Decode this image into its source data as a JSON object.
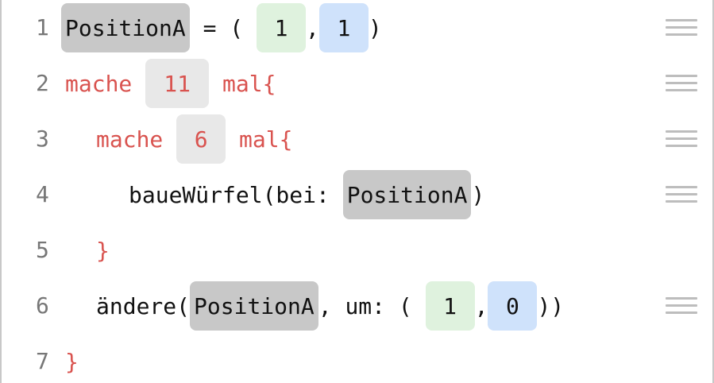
{
  "lines": [
    {
      "number": "1",
      "var_name": "PositionA",
      "assign": " = ( ",
      "x": "1",
      "comma": ",",
      "y": "1",
      "close": ")"
    },
    {
      "number": "2",
      "keyword_start": "mache ",
      "count": "11",
      "keyword_end": " mal{"
    },
    {
      "number": "3",
      "keyword_start": "mache ",
      "count": "6",
      "keyword_end": " mal{"
    },
    {
      "number": "4",
      "call": "baueWürfel(bei: ",
      "arg": "PositionA",
      "close": ")"
    },
    {
      "number": "5",
      "brace": "}"
    },
    {
      "number": "6",
      "call": "ändere(",
      "arg": "PositionA",
      "middle": ", um: ( ",
      "x": "1",
      "comma": ",",
      "y": "0",
      "close": "))"
    },
    {
      "number": "7",
      "brace": "}"
    }
  ],
  "icons": {
    "drag_handle": "drag-handle-icon"
  }
}
